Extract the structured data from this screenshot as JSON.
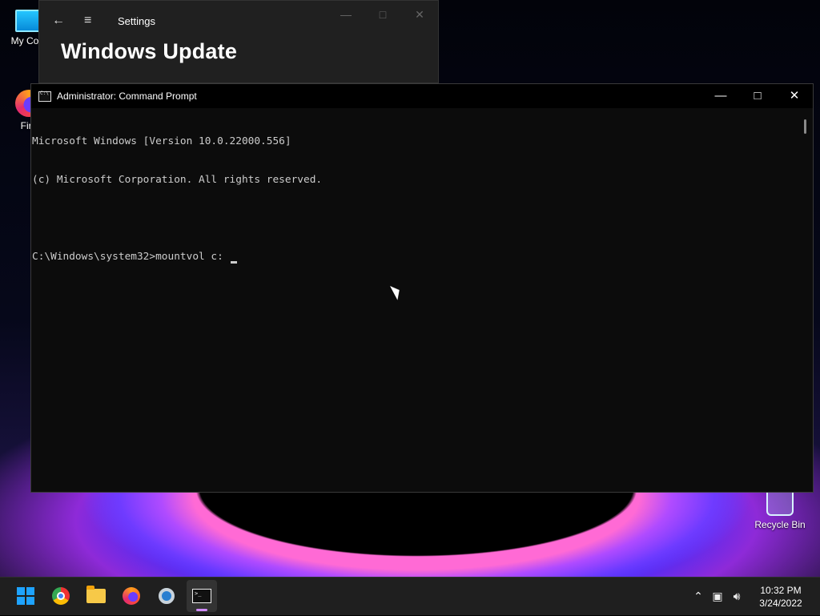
{
  "desktop": {
    "icons": [
      {
        "label": "My Com"
      },
      {
        "label": "Fire"
      },
      {
        "label": "Recycle Bin"
      }
    ]
  },
  "settings_window": {
    "app_title": "Settings",
    "page_title": "Windows Update"
  },
  "cmd_window": {
    "title": "Administrator: Command Prompt",
    "lines": [
      "Microsoft Windows [Version 10.0.22000.556]",
      "(c) Microsoft Corporation. All rights reserved.",
      "",
      "C:\\Windows\\system32>mountvol c: "
    ]
  },
  "taskbar": {
    "apps": [
      "start",
      "chrome",
      "file-explorer",
      "firefox",
      "settings",
      "command-prompt"
    ],
    "active_app": "command-prompt"
  },
  "clock": {
    "time": "10:32 PM",
    "date": "3/24/2022"
  },
  "colors": {
    "console_text": "#cccccc",
    "console_bg": "#0c0c0c",
    "accent": "#1ea3ff"
  }
}
